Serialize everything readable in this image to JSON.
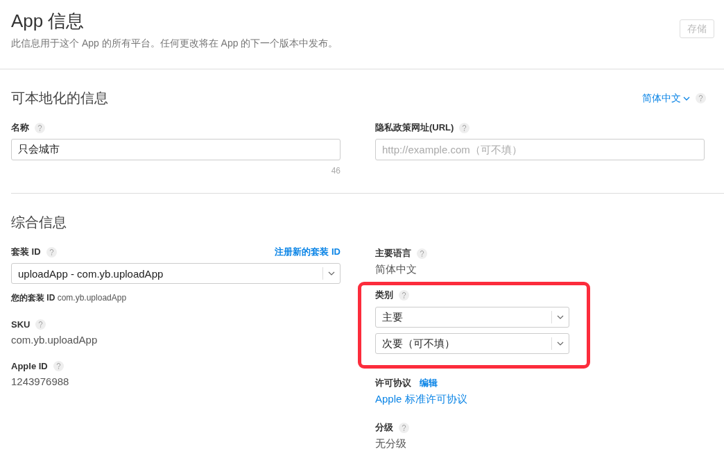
{
  "header": {
    "title": "App 信息",
    "subtitle": "此信息用于这个 App 的所有平台。任何更改将在 App 的下一个版本中发布。",
    "save_button": {
      "label": "存储",
      "disabled": true
    }
  },
  "localizable": {
    "title": "可本地化的信息",
    "language_menu": "简体中文",
    "name": {
      "label": "名称",
      "value": "只会城市",
      "counter": "46"
    },
    "privacy_url": {
      "label": "隐私政策网址(URL)",
      "placeholder": "http://example.com（可不填）"
    }
  },
  "general": {
    "title": "综合信息",
    "bundle_id": {
      "label": "套装 ID",
      "link": "注册新的套装 ID",
      "value": "uploadApp - com.yb.uploadApp",
      "note": "**您的套装 ID** com.yb.uploadApp"
    },
    "sku": {
      "label": "SKU",
      "value": "com.yb.uploadApp"
    },
    "apple_id": {
      "label": "Apple ID",
      "value": "1243976988"
    },
    "primary_language": {
      "label": "主要语言",
      "value": "简体中文"
    },
    "category": {
      "label": "类别",
      "highlighted": true,
      "primary": "主要",
      "secondary": "次要（可不填）"
    },
    "license": {
      "label": "许可协议",
      "edit_link": "编辑",
      "value": "Apple 标准许可协议"
    },
    "rating": {
      "label": "分级",
      "value": "无分级"
    }
  }
}
